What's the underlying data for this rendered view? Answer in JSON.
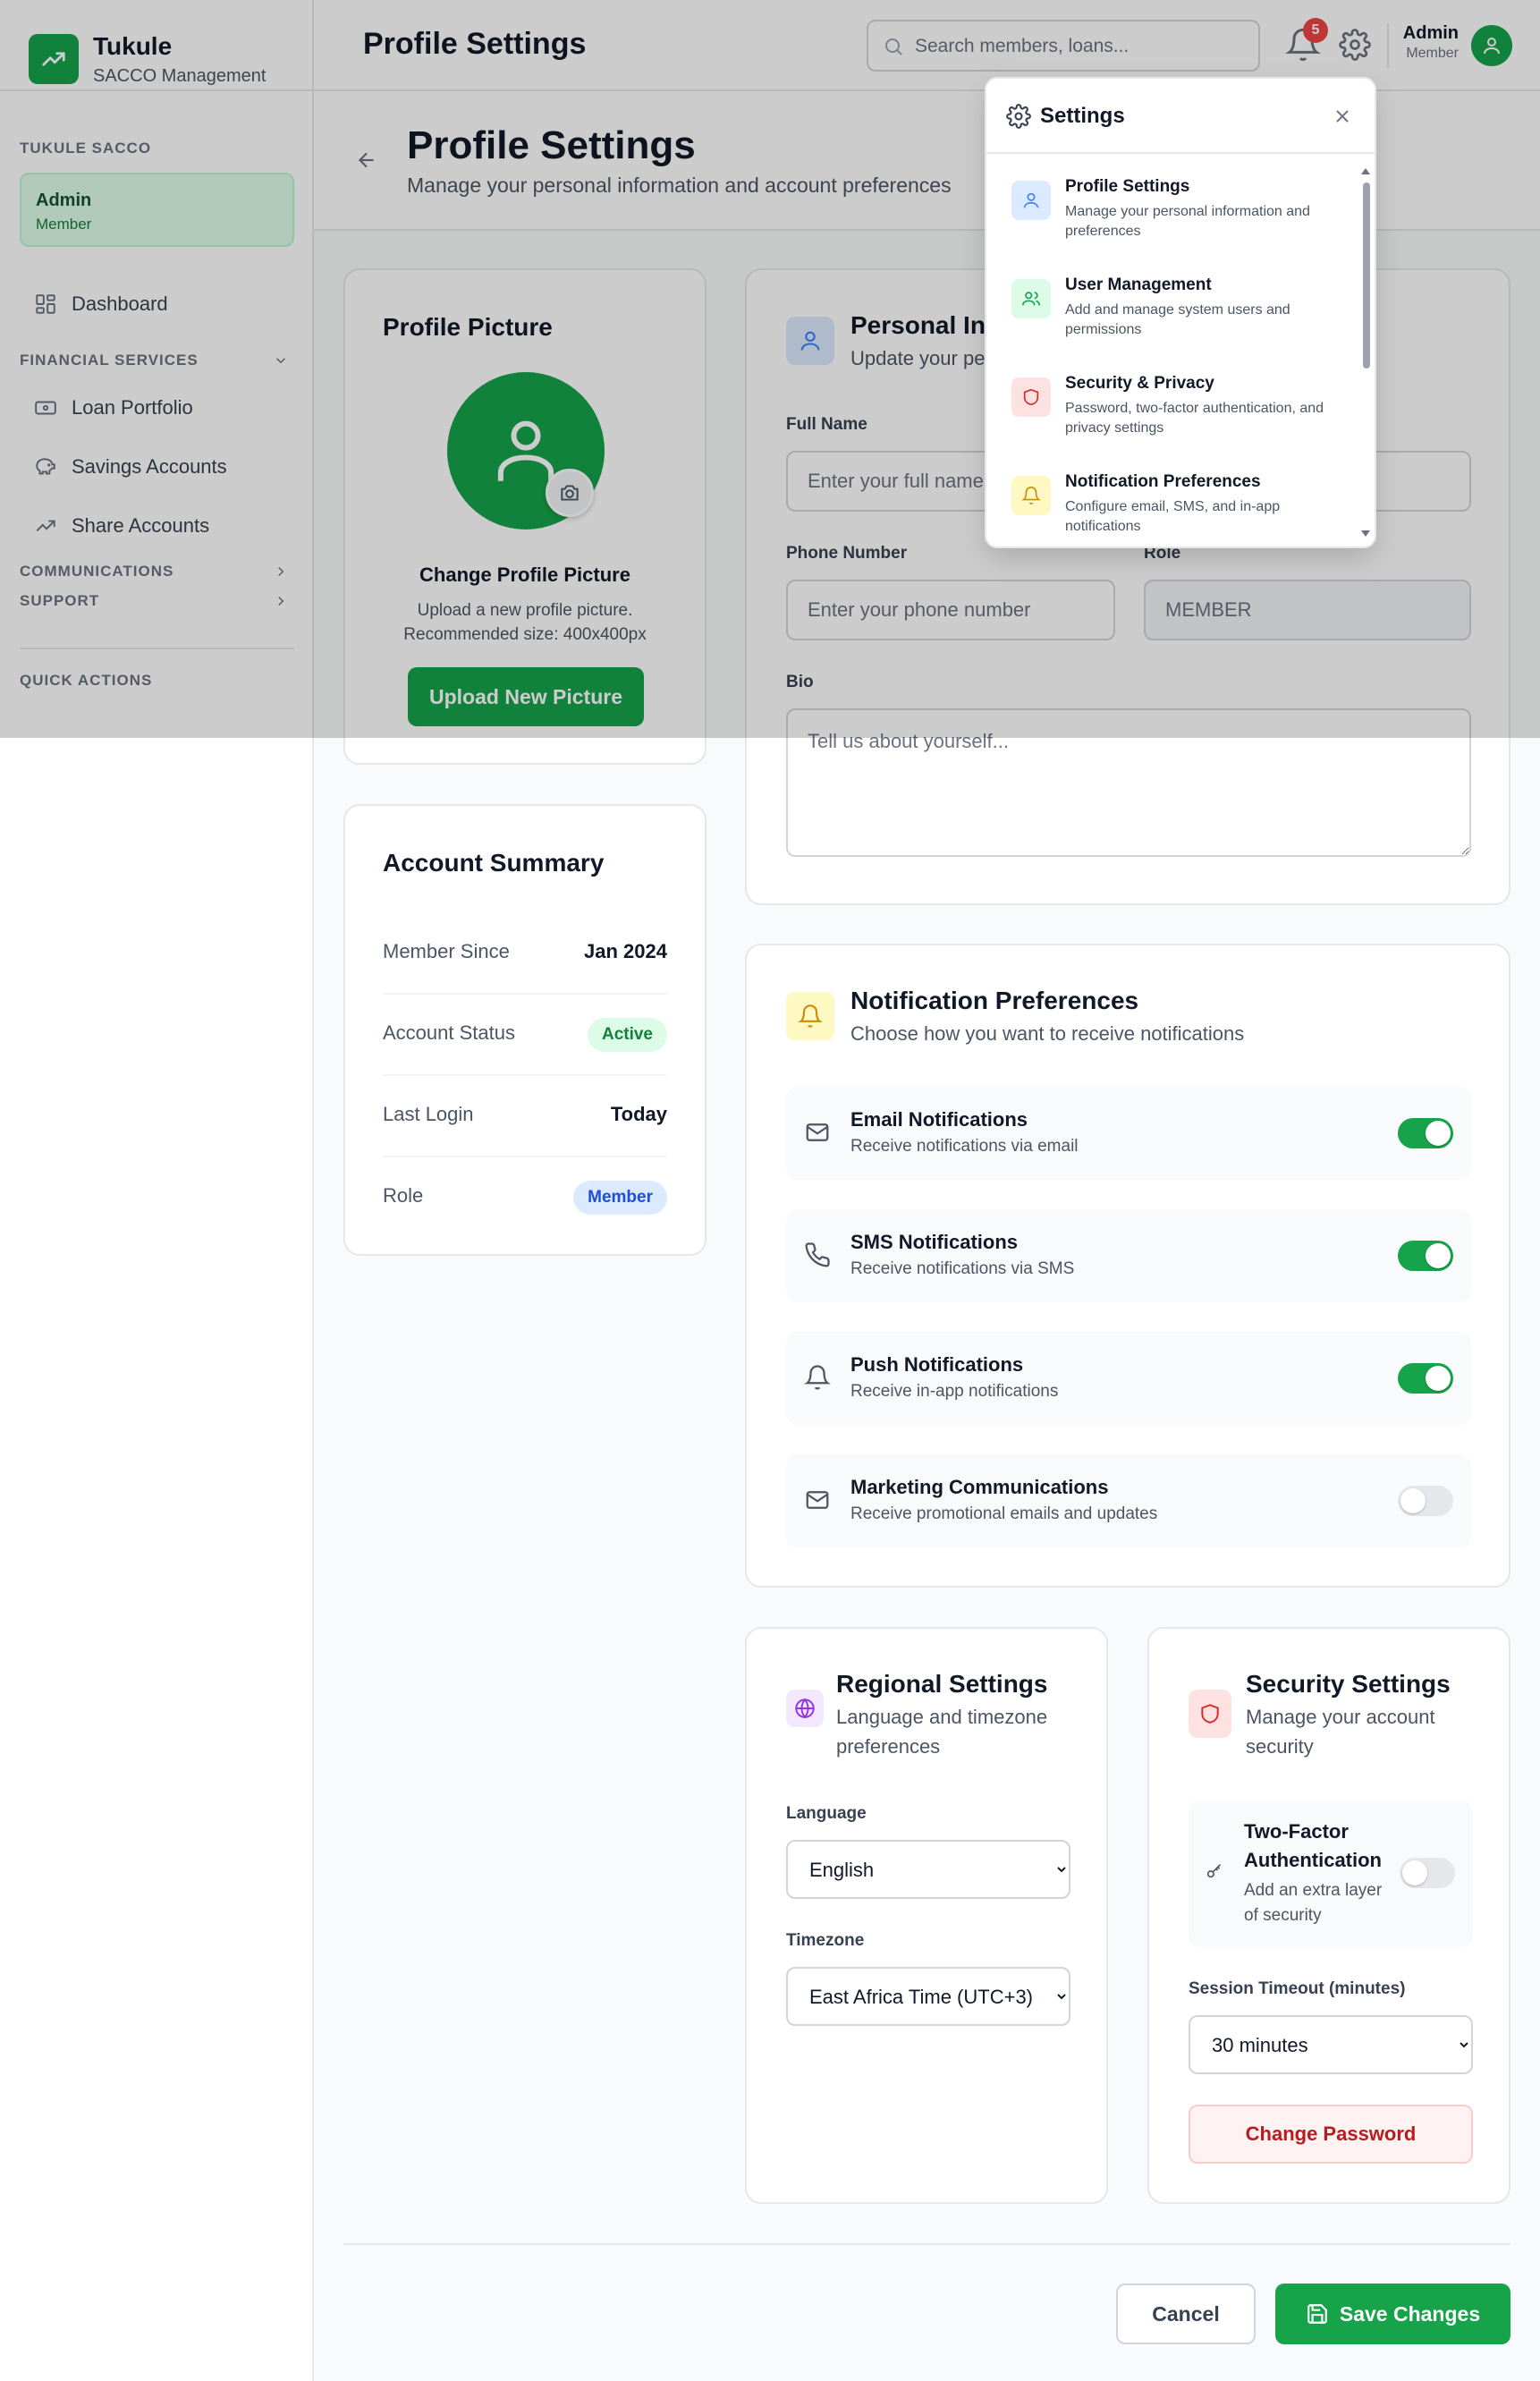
{
  "brand": {
    "name": "Tukule",
    "subtitle": "SACCO Management"
  },
  "sidebar": {
    "org_label": "TUKULE SACCO",
    "user": {
      "name": "Admin",
      "role": "Member"
    },
    "dashboard": "Dashboard",
    "financial_label": "FINANCIAL SERVICES",
    "financial_items": [
      "Loan Portfolio",
      "Savings Accounts",
      "Share Accounts"
    ],
    "communications_label": "COMMUNICATIONS",
    "support_label": "SUPPORT",
    "quick_actions_label": "QUICK ACTIONS"
  },
  "header": {
    "title": "Profile Settings",
    "search_placeholder": "Search members, loans...",
    "notification_count": "5",
    "user_name": "Admin",
    "user_role": "Member"
  },
  "page": {
    "title": "Profile Settings",
    "subtitle": "Manage your personal information and account preferences"
  },
  "profile_picture": {
    "title": "Profile Picture",
    "change_label": "Change Profile Picture",
    "help_line1": "Upload a new profile picture.",
    "help_line2": "Recommended size: 400x400px",
    "upload_button": "Upload New Picture"
  },
  "account_summary": {
    "title": "Account Summary",
    "rows": [
      {
        "key": "Member Since",
        "value": "Jan 2024"
      },
      {
        "key": "Account Status",
        "value": "Active"
      },
      {
        "key": "Last Login",
        "value": "Today"
      },
      {
        "key": "Role",
        "value": "Member"
      }
    ]
  },
  "personal_info": {
    "title": "Personal Information",
    "subtitle": "Update your personal details",
    "full_name_label": "Full Name",
    "full_name_placeholder": "Enter your full name",
    "phone_label": "Phone Number",
    "phone_placeholder": "Enter your phone number",
    "role_label": "Role",
    "role_value": "MEMBER",
    "bio_label": "Bio",
    "bio_placeholder": "Tell us about yourself..."
  },
  "notification_prefs": {
    "title": "Notification Preferences",
    "subtitle": "Choose how you want to receive notifications",
    "items": [
      {
        "title": "Email Notifications",
        "desc": "Receive notifications via email",
        "icon": "mail-icon",
        "enabled": true
      },
      {
        "title": "SMS Notifications",
        "desc": "Receive notifications via SMS",
        "icon": "phone-icon",
        "enabled": true
      },
      {
        "title": "Push Notifications",
        "desc": "Receive in-app notifications",
        "icon": "bell-icon",
        "enabled": true
      },
      {
        "title": "Marketing Communications",
        "desc": "Receive promotional emails and updates",
        "icon": "mail-icon",
        "enabled": false
      }
    ]
  },
  "regional": {
    "title": "Regional Settings",
    "subtitle_line1": "Language and timezone",
    "subtitle_line2": "preferences",
    "language_label": "Language",
    "language_value": "English",
    "timezone_label": "Timezone",
    "timezone_value": "East Africa Time (UTC+3)"
  },
  "security": {
    "title": "Security Settings",
    "subtitle_line1": "Manage your account",
    "subtitle_line2": "security",
    "twofa_title_line1": "Two-Factor",
    "twofa_title_line2": "Authentication",
    "twofa_desc_line1": "Add an extra layer",
    "twofa_desc_line2": "of security",
    "twofa_enabled": false,
    "session_label": "Session Timeout (minutes)",
    "session_value": "30 minutes",
    "change_password": "Change Password"
  },
  "footer": {
    "cancel": "Cancel",
    "save": "Save Changes"
  },
  "settings_menu": {
    "title": "Settings",
    "items": [
      {
        "title": "Profile Settings",
        "desc": "Manage your personal information and preferences",
        "icon": "user-icon"
      },
      {
        "title": "User Management",
        "desc": "Add and manage system users and permissions",
        "icon": "users-icon"
      },
      {
        "title": "Security & Privacy",
        "desc": "Password, two-factor authentication, and privacy settings",
        "icon": "shield-icon"
      },
      {
        "title": "Notification Preferences",
        "desc": "Configure email, SMS, and in-app notifications",
        "icon": "bell-icon"
      }
    ]
  },
  "colors": {
    "primary": "#16a34a",
    "danger": "#dc2626",
    "blue": "#3b82f6",
    "yellow": "#eab308",
    "purple": "#9333ea"
  }
}
